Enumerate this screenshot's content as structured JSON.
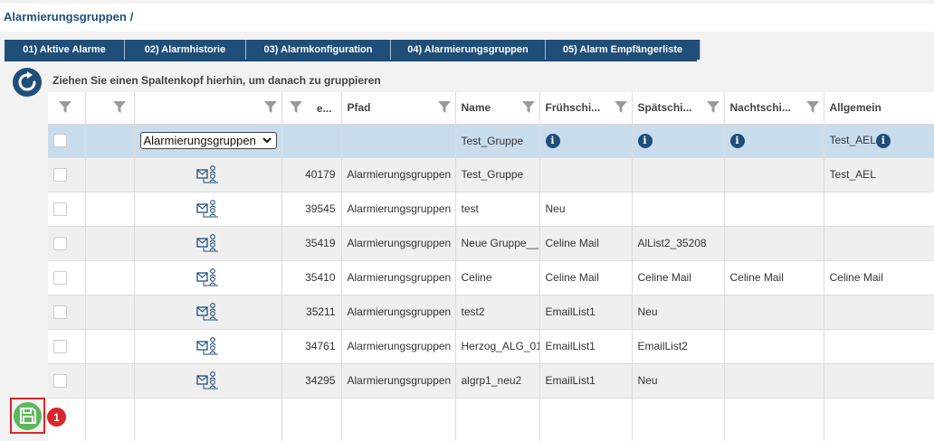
{
  "breadcrumb": {
    "title": "Alarmierungsgruppen",
    "separator": "/"
  },
  "tabs": [
    {
      "label": "01) Aktive Alarme"
    },
    {
      "label": "02) Alarmhistorie"
    },
    {
      "label": "03) Alarmkonfiguration"
    },
    {
      "label": "04) Alarmierungsgruppen"
    },
    {
      "label": "05) Alarm Empfängerliste"
    }
  ],
  "grid": {
    "group_hint": "Ziehen Sie einen Spaltenkopf hierhin, um danach zu gruppieren",
    "columns": [
      "",
      "",
      "",
      "e...",
      "Pfad",
      "Name",
      "Frühschi...",
      "Spätschi...",
      "Nachtschi...",
      "Allgemein"
    ],
    "filter_row": {
      "type_select": "Alarmierungsgruppen",
      "name": "Test_Gruppe",
      "allgemein": "Test_AEL"
    },
    "rows": [
      {
        "id": "40179",
        "pfad": "Alarmierungsgruppen",
        "name": "Test_Gruppe",
        "frueh": "",
        "spaet": "",
        "nacht": "",
        "allgemein": "Test_AEL"
      },
      {
        "id": "39545",
        "pfad": "Alarmierungsgruppen",
        "name": "test",
        "frueh": "Neu",
        "spaet": "",
        "nacht": "",
        "allgemein": ""
      },
      {
        "id": "35419",
        "pfad": "Alarmierungsgruppen",
        "name": "Neue Gruppe__",
        "frueh": "Celine Mail",
        "spaet": "AlList2_35208",
        "nacht": "",
        "allgemein": ""
      },
      {
        "id": "35410",
        "pfad": "Alarmierungsgruppen",
        "name": "Celine",
        "frueh": "Celine Mail",
        "spaet": "Celine Mail",
        "nacht": "Celine Mail",
        "allgemein": "Celine Mail"
      },
      {
        "id": "35211",
        "pfad": "Alarmierungsgruppen",
        "name": "test2",
        "frueh": "EmailList1",
        "spaet": "Neu",
        "nacht": "",
        "allgemein": ""
      },
      {
        "id": "34761",
        "pfad": "Alarmierungsgruppen",
        "name": "Herzog_ALG_01",
        "frueh": "EmailList1",
        "spaet": "EmailList2",
        "nacht": "",
        "allgemein": ""
      },
      {
        "id": "34295",
        "pfad": "Alarmierungsgruppen",
        "name": "algrp1_neu2",
        "frueh": "EmailList1",
        "spaet": "Neu",
        "nacht": "",
        "allgemein": ""
      }
    ]
  },
  "save": {
    "badge": "1"
  },
  "colors": {
    "primary": "#1f4e79",
    "filter_row": "#c9dcec",
    "save_green": "#5cb85c",
    "badge_red": "#d9262c"
  }
}
